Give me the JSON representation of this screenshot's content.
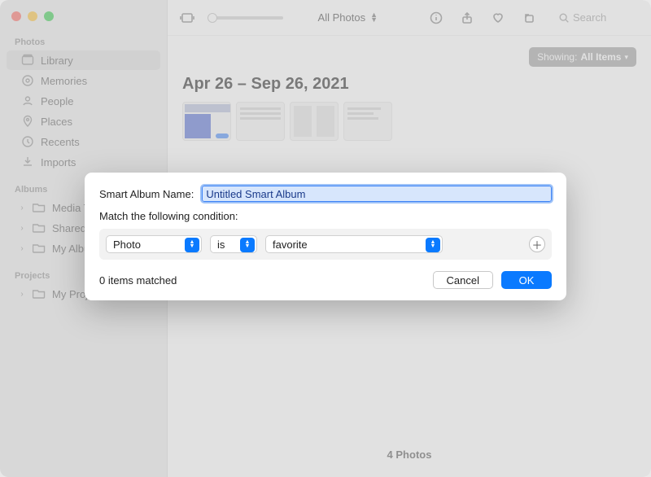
{
  "toolbar": {
    "filter_label": "All Photos",
    "search_placeholder": "Search"
  },
  "showing": {
    "prefix": "Showing:",
    "value": "All Items"
  },
  "date_range": "Apr 26 – Sep 26, 2021",
  "photo_count_label": "4 Photos",
  "sidebar": {
    "sections": {
      "photos": {
        "title": "Photos",
        "items": [
          {
            "label": "Library",
            "selected": true
          },
          {
            "label": "Memories"
          },
          {
            "label": "People"
          },
          {
            "label": "Places"
          },
          {
            "label": "Recents"
          },
          {
            "label": "Imports"
          }
        ]
      },
      "albums": {
        "title": "Albums",
        "items": [
          {
            "label": "Media Types"
          },
          {
            "label": "Shared Albums"
          },
          {
            "label": "My Albums"
          }
        ]
      },
      "projects": {
        "title": "Projects",
        "items": [
          {
            "label": "My Projects"
          }
        ]
      }
    }
  },
  "modal": {
    "name_label": "Smart Album Name:",
    "name_value": "Untitled Smart Album",
    "condition_label": "Match the following condition:",
    "field_value": "Photo",
    "operator_value": "is",
    "criteria_value": "favorite",
    "matched_text": "0 items matched",
    "cancel_label": "Cancel",
    "ok_label": "OK"
  }
}
